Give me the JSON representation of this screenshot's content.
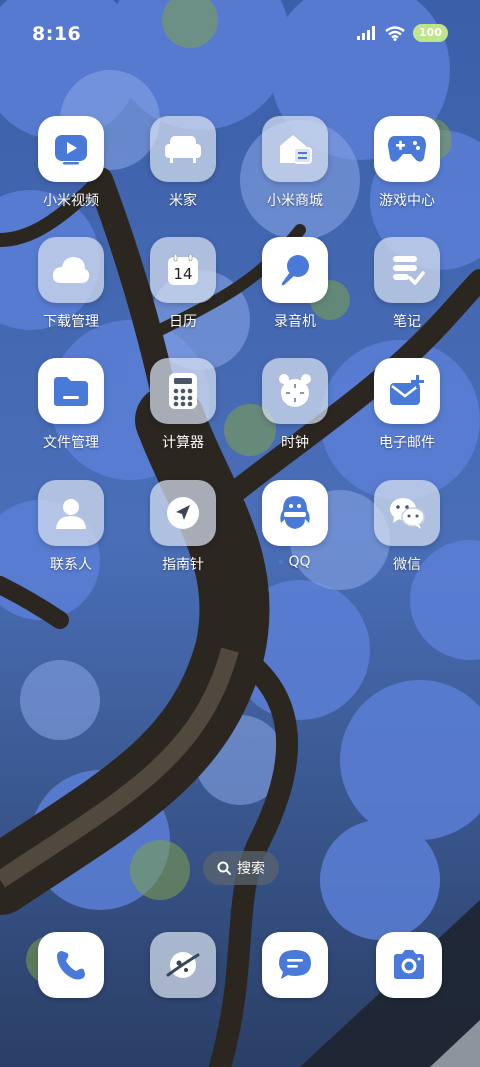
{
  "status_bar": {
    "time": "8:16",
    "battery": "100",
    "battery_color": "#bfe58a"
  },
  "accent_color": "#4a7ad8",
  "apps": [
    {
      "label": "小米视频",
      "icon": "video-play-icon",
      "style": "white"
    },
    {
      "label": "米家",
      "icon": "sofa-icon",
      "style": "glass"
    },
    {
      "label": "小米商城",
      "icon": "store-bag-icon",
      "style": "glass"
    },
    {
      "label": "游戏中心",
      "icon": "gamepad-icon",
      "style": "white"
    },
    {
      "label": "下载管理",
      "icon": "cloud-icon",
      "style": "glass"
    },
    {
      "label": "日历",
      "icon": "calendar-icon",
      "style": "glass",
      "calendar_day": "14"
    },
    {
      "label": "录音机",
      "icon": "microphone-icon",
      "style": "white"
    },
    {
      "label": "笔记",
      "icon": "notes-check-icon",
      "style": "glass"
    },
    {
      "label": "文件管理",
      "icon": "folder-icon",
      "style": "white"
    },
    {
      "label": "计算器",
      "icon": "calculator-icon",
      "style": "glass"
    },
    {
      "label": "时钟",
      "icon": "alarm-clock-icon",
      "style": "glass"
    },
    {
      "label": "电子邮件",
      "icon": "mail-plus-icon",
      "style": "white"
    },
    {
      "label": "联系人",
      "icon": "contact-person-icon",
      "style": "glass"
    },
    {
      "label": "指南针",
      "icon": "compass-arrow-icon",
      "style": "glass"
    },
    {
      "label": "QQ",
      "icon": "qq-penguin-icon",
      "style": "white"
    },
    {
      "label": "微信",
      "icon": "wechat-icon",
      "style": "glass"
    }
  ],
  "search": {
    "label": "搜索",
    "icon": "search-icon"
  },
  "dock": [
    {
      "name": "phone",
      "icon": "phone-icon",
      "style": "white"
    },
    {
      "name": "browser",
      "icon": "browser-planet-icon",
      "style": "glass"
    },
    {
      "name": "messages",
      "icon": "message-bubble-icon",
      "style": "white"
    },
    {
      "name": "camera",
      "icon": "camera-icon",
      "style": "white"
    }
  ]
}
